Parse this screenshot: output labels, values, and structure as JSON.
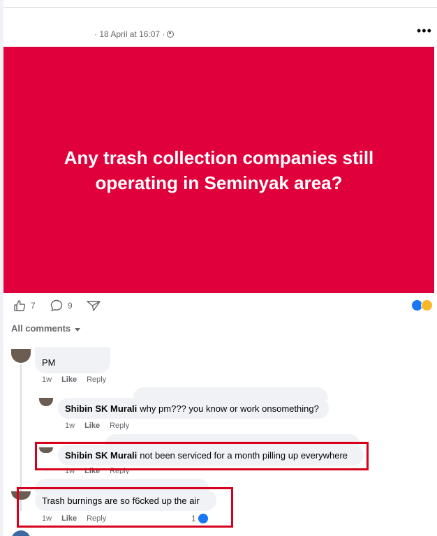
{
  "post": {
    "meta": "· 18 April at 16:07 ·",
    "more_label": "•••",
    "banner_text": "Any trash collection companies still operating in Seminyak area?",
    "banner_color": "#e0003b"
  },
  "actions": {
    "likes": "7",
    "comments": "9"
  },
  "comments_filter": "All comments",
  "comments": [
    {
      "text": "PM",
      "time": "1w",
      "like": "Like",
      "reply": "Reply"
    },
    {
      "author": "Shibin SK Murali",
      "text": "why pm??? you know or work onsomething?",
      "time": "1w",
      "like": "Like",
      "reply": "Reply"
    },
    {
      "author": "Shibin SK Murali",
      "text": "not been serviced for a month pilling up everywhere",
      "time": "1w",
      "like": "Like",
      "reply": "Reply"
    },
    {
      "text": "Trash burnings are so f6cked up the air",
      "time": "1w",
      "like": "Like",
      "reply": "Reply",
      "reaction_count": "1"
    }
  ],
  "colors": {
    "highlight": "#d7001c",
    "accent": "#1877f2"
  }
}
